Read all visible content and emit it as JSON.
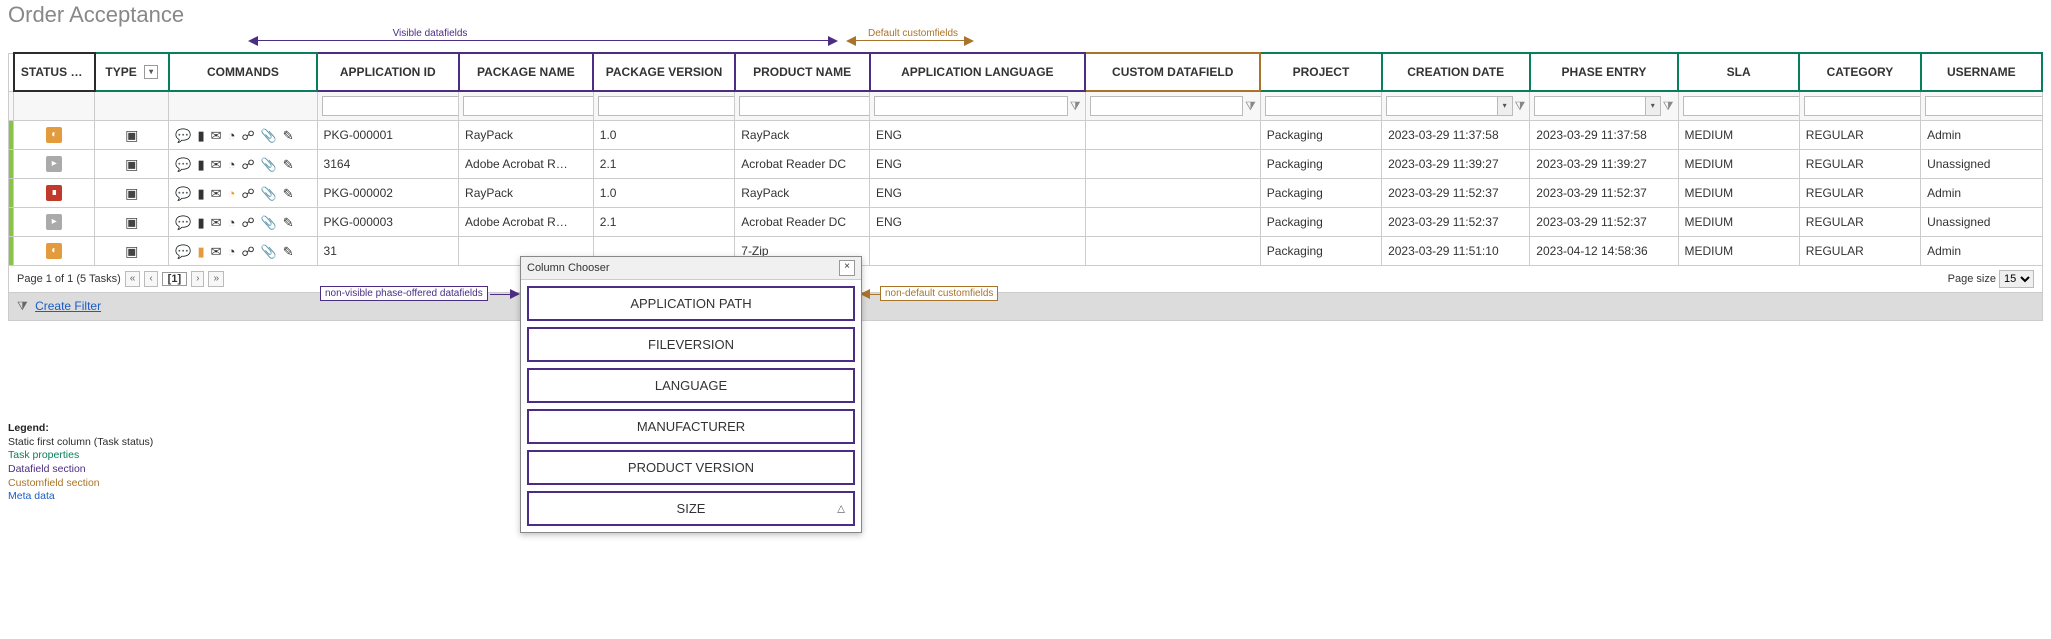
{
  "title": "Order Acceptance",
  "annotations": {
    "visible_datafields": "Visible datafields",
    "default_customfields": "Default customfields",
    "nonvisible_datafields": "non-visible phase-offered datafields",
    "nondefault_customfields": "non-default customfields"
  },
  "columns": {
    "status": "STATUS",
    "type": "TYPE",
    "commands": "COMMANDS",
    "application_id": "APPLICATION ID",
    "package_name": "PACKAGE NAME",
    "package_version": "PACKAGE VERSION",
    "product_name": "PRODUCT NAME",
    "application_language": "APPLICATION LANGUAGE",
    "custom_datafield": "CUSTOM DATAFIELD",
    "project": "PROJECT",
    "creation_date": "CREATION DATE",
    "phase_entry": "PHASE ENTRY",
    "sla": "SLA",
    "category": "CATEGORY",
    "username": "USERNAME"
  },
  "rows": [
    {
      "status": "orange",
      "application_id": "PKG-000001",
      "package_name": "RayPack",
      "package_version": "1.0",
      "product_name": "RayPack",
      "app_lang": "ENG",
      "project": "Packaging",
      "creation": "2023-03-29 11:37:58",
      "phase": "2023-03-29 11:37:58",
      "sla": "MEDIUM",
      "category": "REGULAR",
      "user": "Admin",
      "cmd_variant": "normal"
    },
    {
      "status": "gray",
      "application_id": "3164",
      "package_name": "Adobe Acrobat R…",
      "package_version": "2.1",
      "product_name": "Acrobat Reader DC",
      "app_lang": "ENG",
      "project": "Packaging",
      "creation": "2023-03-29 11:39:27",
      "phase": "2023-03-29 11:39:27",
      "sla": "MEDIUM",
      "category": "REGULAR",
      "user": "Unassigned",
      "cmd_variant": "normal"
    },
    {
      "status": "red",
      "application_id": "PKG-000002",
      "package_name": "RayPack",
      "package_version": "1.0",
      "product_name": "RayPack",
      "app_lang": "ENG",
      "project": "Packaging",
      "creation": "2023-03-29 11:52:37",
      "phase": "2023-03-29 11:52:37",
      "sla": "MEDIUM",
      "category": "REGULAR",
      "user": "Admin",
      "cmd_variant": "alt"
    },
    {
      "status": "gray",
      "application_id": "PKG-000003",
      "package_name": "Adobe Acrobat R…",
      "package_version": "2.1",
      "product_name": "Acrobat Reader DC",
      "app_lang": "ENG",
      "project": "Packaging",
      "creation": "2023-03-29 11:52:37",
      "phase": "2023-03-29 11:52:37",
      "sla": "MEDIUM",
      "category": "REGULAR",
      "user": "Unassigned",
      "cmd_variant": "normal"
    },
    {
      "status": "orange",
      "application_id": "31",
      "package_name": "",
      "package_version": "",
      "product_name": "7-Zip",
      "app_lang": "",
      "project": "Packaging",
      "creation": "2023-03-29 11:51:10",
      "phase": "2023-04-12 14:58:36",
      "sla": "MEDIUM",
      "category": "REGULAR",
      "user": "Admin",
      "cmd_variant": "orange"
    }
  ],
  "pager": {
    "summary": "Page 1 of 1 (5 Tasks)",
    "current": "1",
    "page_size_label": "Page size",
    "page_size_value": "15"
  },
  "filter_bar": {
    "create_filter": "Create Filter"
  },
  "column_chooser": {
    "title": "Column Chooser",
    "items": [
      "APPLICATION PATH",
      "FILEVERSION",
      "LANGUAGE",
      "MANUFACTURER",
      "PRODUCT VERSION",
      "SIZE"
    ]
  },
  "legend": {
    "title": "Legend:",
    "static": "Static first column (Task status)",
    "task": "Task properties",
    "data": "Datafield section",
    "custom": "Customfield section",
    "meta": "Meta data"
  }
}
